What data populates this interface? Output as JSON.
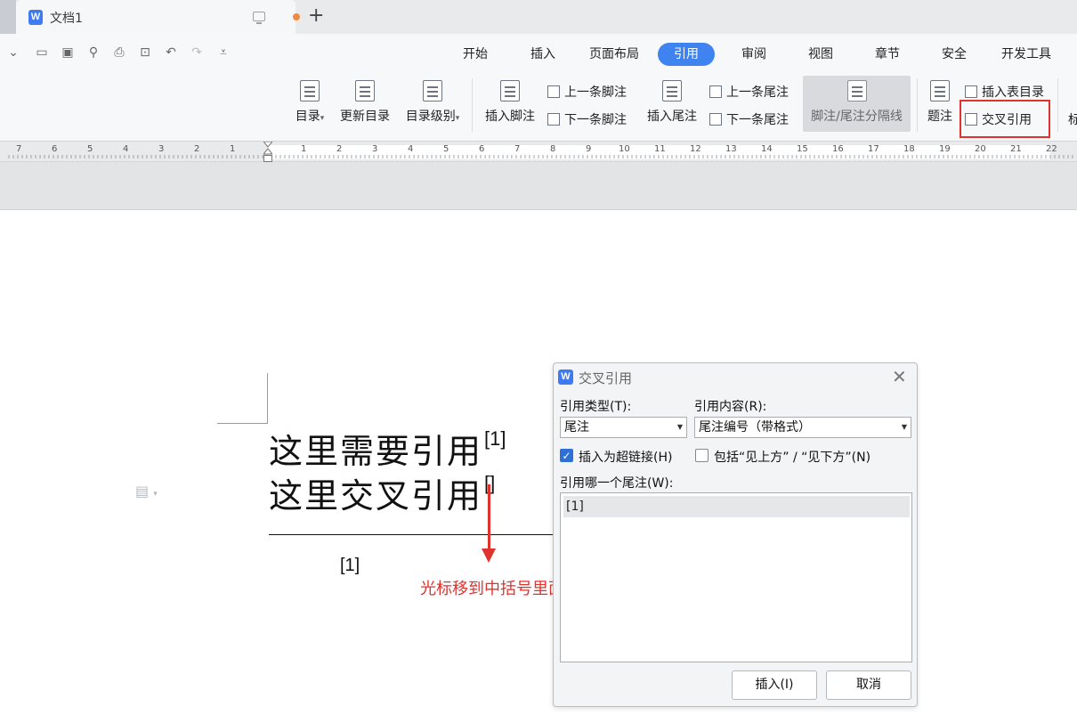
{
  "titlebar": {
    "tab_title": "文档1",
    "doc_icon": "W",
    "new_tab": "+"
  },
  "quick_access": [
    "chevron-down-icon",
    "open-folder-icon",
    "save-icon",
    "find-icon",
    "print-icon",
    "print-preview-icon",
    "undo-icon",
    "redo-icon",
    "customize-icon"
  ],
  "menu_tabs": [
    "开始",
    "插入",
    "页面布局",
    "引用",
    "审阅",
    "视图",
    "章节",
    "安全",
    "开发工具"
  ],
  "active_menu_tab": "引用",
  "ribbon": {
    "toc": "目录",
    "update_toc": "更新目录",
    "toc_level": "目录级别",
    "insert_footnote": "插入脚注",
    "prev_footnote": "上一条脚注",
    "next_footnote": "下一条脚注",
    "insert_endnote": "插入尾注",
    "prev_endnote": "上一条尾注",
    "next_endnote": "下一条尾注",
    "note_separator": "脚注/尾注分隔线",
    "caption": "题注",
    "insert_table_of_figures": "插入表目录",
    "cross_reference": "交叉引用",
    "cut_off": "标"
  },
  "ruler": {
    "numbers": [
      "7",
      "6",
      "5",
      "4",
      "3",
      "2",
      "1",
      "1",
      "2",
      "3",
      "4",
      "5",
      "6",
      "7",
      "8",
      "9",
      "10",
      "11",
      "12",
      "13",
      "14",
      "15",
      "16",
      "17",
      "18",
      "19",
      "20",
      "21",
      "22"
    ]
  },
  "document": {
    "line1": "这里需要引用",
    "line1_sup": "[1]",
    "line2": "这里交叉引用",
    "line2_sup": "[]",
    "footnote": "[1]",
    "annotation": "光标移到中括号里面"
  },
  "dialog": {
    "icon": "W",
    "title": "交叉引用",
    "close": "✕",
    "ref_type_label": "引用类型(T):",
    "ref_type_value": "尾注",
    "ref_content_label": "引用内容(R):",
    "ref_content_value": "尾注编号（带格式）",
    "hyperlink_label": "插入为超链接(H)",
    "hyperlink_checked": true,
    "above_below_label": "包括“见上方” / “见下方”(N)",
    "above_below_checked": false,
    "which_label": "引用哪一个尾注(W):",
    "items": [
      "[1]"
    ],
    "insert_button": "插入(I)",
    "cancel_button": "取消"
  },
  "colors": {
    "accent": "#3f83f0",
    "annotation_red": "#e0332e"
  }
}
